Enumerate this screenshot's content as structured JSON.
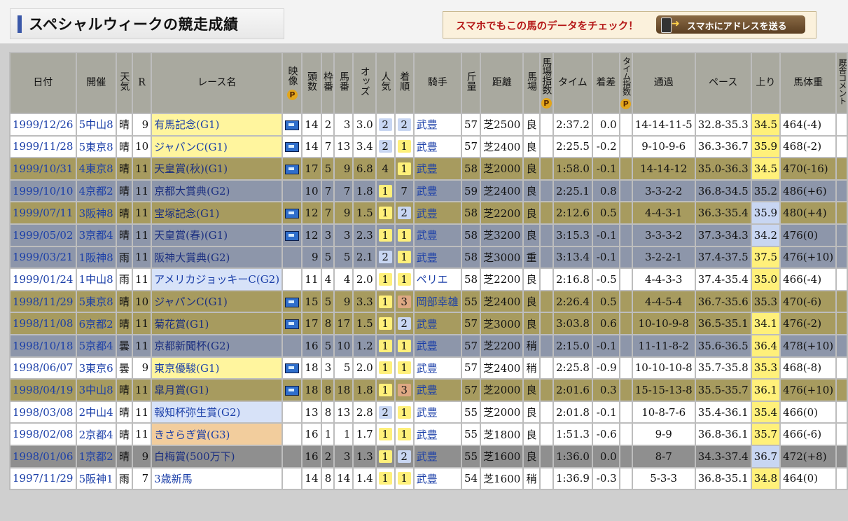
{
  "page_title": "スペシャルウィークの競走成績",
  "promo": {
    "text": "スマホでもこの馬のデータをチェック！",
    "button_label": "スマホにアドレスを送る"
  },
  "headers": {
    "date": "日付",
    "venue": "開催",
    "weather": "天気",
    "round": "R",
    "race_name": "レース名",
    "video": "映像",
    "runners": "頭数",
    "frame": "枠番",
    "horse_no": "馬番",
    "odds": "オッズ",
    "popularity": "人気",
    "finish": "着順",
    "jockey": "騎手",
    "weight_carried": "斤量",
    "distance": "距離",
    "track": "馬場",
    "track_index": "馬場指数",
    "time": "タイム",
    "margin": "着差",
    "time_index": "タイム指数",
    "passing": "通過",
    "pace": "ペース",
    "last3f": "上り",
    "body_weight": "馬体重",
    "extra": "厩舎コメント",
    "p_badge": "P"
  },
  "rows": [
    {
      "style": "white",
      "date": "1999/12/26",
      "venue": "5中山8",
      "weather": "晴",
      "round": "9",
      "race": "有馬記念(G1)",
      "race_grade": "g1",
      "video": true,
      "runners": "14",
      "frame": "2",
      "horse_no": "3",
      "odds": "3.0",
      "pop": "2",
      "pop_rank": 2,
      "finish": "2",
      "finish_rank": 2,
      "jockey": "武豊",
      "kg": "57",
      "distance": "芝2500",
      "track": "良",
      "time": "2:37.2",
      "margin": "0.0",
      "passing": "14-14-11-5",
      "pace": "32.8-35.3",
      "last3f": "34.5",
      "last3f_rank": 1,
      "body_weight": "464(-4)"
    },
    {
      "style": "white",
      "date": "1999/11/28",
      "venue": "5東京8",
      "weather": "晴",
      "round": "10",
      "race": "ジャパンC(G1)",
      "race_grade": "g1",
      "video": true,
      "runners": "14",
      "frame": "7",
      "horse_no": "13",
      "odds": "3.4",
      "pop": "2",
      "pop_rank": 2,
      "finish": "1",
      "finish_rank": 1,
      "jockey": "武豊",
      "kg": "57",
      "distance": "芝2400",
      "track": "良",
      "time": "2:25.5",
      "margin": "-0.2",
      "passing": "9-10-9-6",
      "pace": "36.3-36.7",
      "last3f": "35.9",
      "last3f_rank": 1,
      "body_weight": "468(-2)"
    },
    {
      "style": "olive",
      "date": "1999/10/31",
      "venue": "4東京8",
      "weather": "晴",
      "round": "11",
      "race": "天皇賞(秋)(G1)",
      "race_grade": "g1",
      "video": true,
      "runners": "17",
      "frame": "5",
      "horse_no": "9",
      "odds": "6.8",
      "pop": "4",
      "pop_rank": 0,
      "finish": "1",
      "finish_rank": 1,
      "jockey": "武豊",
      "kg": "58",
      "distance": "芝2000",
      "track": "良",
      "time": "1:58.0",
      "margin": "-0.1",
      "passing": "14-14-12",
      "pace": "35.0-36.3",
      "last3f": "34.5",
      "last3f_rank": 1,
      "body_weight": "470(-16)"
    },
    {
      "style": "slate",
      "date": "1999/10/10",
      "venue": "4京都2",
      "weather": "晴",
      "round": "11",
      "race": "京都大賞典(G2)",
      "race_grade": "g2",
      "video": false,
      "runners": "10",
      "frame": "7",
      "horse_no": "7",
      "odds": "1.8",
      "pop": "1",
      "pop_rank": 1,
      "finish": "7",
      "finish_rank": 0,
      "jockey": "武豊",
      "kg": "59",
      "distance": "芝2400",
      "track": "良",
      "time": "2:25.1",
      "margin": "0.8",
      "passing": "3-3-2-2",
      "pace": "36.8-34.5",
      "last3f": "35.2",
      "last3f_rank": 0,
      "body_weight": "486(+6)"
    },
    {
      "style": "olive",
      "date": "1999/07/11",
      "venue": "3阪神8",
      "weather": "晴",
      "round": "11",
      "race": "宝塚記念(G1)",
      "race_grade": "g1",
      "video": true,
      "runners": "12",
      "frame": "7",
      "horse_no": "9",
      "odds": "1.5",
      "pop": "1",
      "pop_rank": 1,
      "finish": "2",
      "finish_rank": 2,
      "jockey": "武豊",
      "kg": "58",
      "distance": "芝2200",
      "track": "良",
      "time": "2:12.6",
      "margin": "0.5",
      "passing": "4-4-3-1",
      "pace": "36.3-35.4",
      "last3f": "35.9",
      "last3f_rank": 2,
      "body_weight": "480(+4)"
    },
    {
      "style": "slate",
      "date": "1999/05/02",
      "venue": "3京都4",
      "weather": "晴",
      "round": "11",
      "race": "天皇賞(春)(G1)",
      "race_grade": "g1",
      "video": true,
      "runners": "12",
      "frame": "3",
      "horse_no": "3",
      "odds": "2.3",
      "pop": "1",
      "pop_rank": 1,
      "finish": "1",
      "finish_rank": 1,
      "jockey": "武豊",
      "kg": "58",
      "distance": "芝3200",
      "track": "良",
      "time": "3:15.3",
      "margin": "-0.1",
      "passing": "3-3-3-2",
      "pace": "37.3-34.3",
      "last3f": "34.2",
      "last3f_rank": 2,
      "body_weight": "476(0)"
    },
    {
      "style": "slate",
      "date": "1999/03/21",
      "venue": "1阪神8",
      "weather": "雨",
      "round": "11",
      "race": "阪神大賞典(G2)",
      "race_grade": "g2",
      "video": false,
      "runners": "9",
      "frame": "5",
      "horse_no": "5",
      "odds": "2.1",
      "pop": "2",
      "pop_rank": 2,
      "finish": "1",
      "finish_rank": 1,
      "jockey": "武豊",
      "kg": "58",
      "distance": "芝3000",
      "track": "重",
      "time": "3:13.4",
      "margin": "-0.1",
      "passing": "3-2-2-1",
      "pace": "37.4-37.5",
      "last3f": "37.5",
      "last3f_rank": 1,
      "body_weight": "476(+10)"
    },
    {
      "style": "white",
      "date": "1999/01/24",
      "venue": "1中山8",
      "weather": "雨",
      "round": "11",
      "race": "アメリカジョッキーC(G2)",
      "race_grade": "g2",
      "video": false,
      "runners": "11",
      "frame": "4",
      "horse_no": "4",
      "odds": "2.0",
      "pop": "1",
      "pop_rank": 1,
      "finish": "1",
      "finish_rank": 1,
      "jockey": "ペリエ",
      "kg": "58",
      "distance": "芝2200",
      "track": "良",
      "time": "2:16.8",
      "margin": "-0.5",
      "passing": "4-4-3-3",
      "pace": "37.4-35.4",
      "last3f": "35.0",
      "last3f_rank": 1,
      "body_weight": "466(-4)"
    },
    {
      "style": "olive",
      "date": "1998/11/29",
      "venue": "5東京8",
      "weather": "晴",
      "round": "10",
      "race": "ジャパンC(G1)",
      "race_grade": "g1",
      "video": true,
      "runners": "15",
      "frame": "5",
      "horse_no": "9",
      "odds": "3.3",
      "pop": "1",
      "pop_rank": 1,
      "finish": "3",
      "finish_rank": 3,
      "jockey": "岡部幸雄",
      "kg": "55",
      "distance": "芝2400",
      "track": "良",
      "time": "2:26.4",
      "margin": "0.5",
      "passing": "4-4-5-4",
      "pace": "36.7-35.6",
      "last3f": "35.3",
      "last3f_rank": 0,
      "body_weight": "470(-6)"
    },
    {
      "style": "olive",
      "date": "1998/11/08",
      "venue": "6京都2",
      "weather": "晴",
      "round": "11",
      "race": "菊花賞(G1)",
      "race_grade": "g1",
      "video": true,
      "runners": "17",
      "frame": "8",
      "horse_no": "17",
      "odds": "1.5",
      "pop": "1",
      "pop_rank": 1,
      "finish": "2",
      "finish_rank": 2,
      "jockey": "武豊",
      "kg": "57",
      "distance": "芝3000",
      "track": "良",
      "time": "3:03.8",
      "margin": "0.6",
      "passing": "10-10-9-8",
      "pace": "36.5-35.1",
      "last3f": "34.1",
      "last3f_rank": 1,
      "body_weight": "476(-2)"
    },
    {
      "style": "slate",
      "date": "1998/10/18",
      "venue": "5京都4",
      "weather": "曇",
      "round": "11",
      "race": "京都新聞杯(G2)",
      "race_grade": "g2",
      "video": false,
      "runners": "16",
      "frame": "5",
      "horse_no": "10",
      "odds": "1.2",
      "pop": "1",
      "pop_rank": 1,
      "finish": "1",
      "finish_rank": 1,
      "jockey": "武豊",
      "kg": "57",
      "distance": "芝2200",
      "track": "稍",
      "time": "2:15.0",
      "margin": "-0.1",
      "passing": "11-11-8-2",
      "pace": "35.6-36.5",
      "last3f": "36.4",
      "last3f_rank": 1,
      "body_weight": "478(+10)"
    },
    {
      "style": "white",
      "date": "1998/06/07",
      "venue": "3東京6",
      "weather": "曇",
      "round": "9",
      "race": "東京優駿(G1)",
      "race_grade": "g1",
      "video": true,
      "runners": "18",
      "frame": "3",
      "horse_no": "5",
      "odds": "2.0",
      "pop": "1",
      "pop_rank": 1,
      "finish": "1",
      "finish_rank": 1,
      "jockey": "武豊",
      "kg": "57",
      "distance": "芝2400",
      "track": "稍",
      "time": "2:25.8",
      "margin": "-0.9",
      "passing": "10-10-10-8",
      "pace": "35.7-35.8",
      "last3f": "35.3",
      "last3f_rank": 1,
      "body_weight": "468(-8)"
    },
    {
      "style": "olive",
      "date": "1998/04/19",
      "venue": "3中山8",
      "weather": "晴",
      "round": "11",
      "race": "皐月賞(G1)",
      "race_grade": "g1",
      "video": true,
      "runners": "18",
      "frame": "8",
      "horse_no": "18",
      "odds": "1.8",
      "pop": "1",
      "pop_rank": 1,
      "finish": "3",
      "finish_rank": 3,
      "jockey": "武豊",
      "kg": "57",
      "distance": "芝2000",
      "track": "良",
      "time": "2:01.6",
      "margin": "0.3",
      "passing": "15-15-13-8",
      "pace": "35.5-35.7",
      "last3f": "36.1",
      "last3f_rank": 1,
      "body_weight": "476(+10)"
    },
    {
      "style": "white",
      "date": "1998/03/08",
      "venue": "2中山4",
      "weather": "晴",
      "round": "11",
      "race": "報知杯弥生賞(G2)",
      "race_grade": "g2",
      "video": false,
      "runners": "13",
      "frame": "8",
      "horse_no": "13",
      "odds": "2.8",
      "pop": "2",
      "pop_rank": 2,
      "finish": "1",
      "finish_rank": 1,
      "jockey": "武豊",
      "kg": "55",
      "distance": "芝2000",
      "track": "良",
      "time": "2:01.8",
      "margin": "-0.1",
      "passing": "10-8-7-6",
      "pace": "35.4-36.1",
      "last3f": "35.4",
      "last3f_rank": 1,
      "body_weight": "466(0)"
    },
    {
      "style": "white",
      "date": "1998/02/08",
      "venue": "2京都4",
      "weather": "晴",
      "round": "11",
      "race": "きさらぎ賞(G3)",
      "race_grade": "g3",
      "video": false,
      "runners": "16",
      "frame": "1",
      "horse_no": "1",
      "odds": "1.7",
      "pop": "1",
      "pop_rank": 1,
      "finish": "1",
      "finish_rank": 1,
      "jockey": "武豊",
      "kg": "55",
      "distance": "芝1800",
      "track": "良",
      "time": "1:51.3",
      "margin": "-0.6",
      "passing": "9-9",
      "pace": "36.8-36.1",
      "last3f": "35.7",
      "last3f_rank": 1,
      "body_weight": "466(-6)"
    },
    {
      "style": "grey",
      "date": "1998/01/06",
      "venue": "1京都2",
      "weather": "晴",
      "round": "9",
      "race": "白梅賞(500万下)",
      "race_grade": "",
      "video": false,
      "runners": "16",
      "frame": "2",
      "horse_no": "3",
      "odds": "1.3",
      "pop": "1",
      "pop_rank": 1,
      "finish": "2",
      "finish_rank": 2,
      "jockey": "武豊",
      "kg": "55",
      "distance": "芝1600",
      "track": "良",
      "time": "1:36.0",
      "margin": "0.0",
      "passing": "8-7",
      "pace": "34.3-37.4",
      "last3f": "36.7",
      "last3f_rank": 2,
      "body_weight": "472(+8)"
    },
    {
      "style": "white",
      "date": "1997/11/29",
      "venue": "5阪神1",
      "weather": "雨",
      "round": "7",
      "race": "3歳新馬",
      "race_grade": "",
      "video": false,
      "runners": "14",
      "frame": "8",
      "horse_no": "14",
      "odds": "1.4",
      "pop": "1",
      "pop_rank": 1,
      "finish": "1",
      "finish_rank": 1,
      "jockey": "武豊",
      "kg": "54",
      "distance": "芝1600",
      "track": "稍",
      "time": "1:36.9",
      "margin": "-0.3",
      "passing": "5-3-3",
      "pace": "36.8-35.1",
      "last3f": "34.8",
      "last3f_rank": 1,
      "body_weight": "464(0)"
    }
  ]
}
